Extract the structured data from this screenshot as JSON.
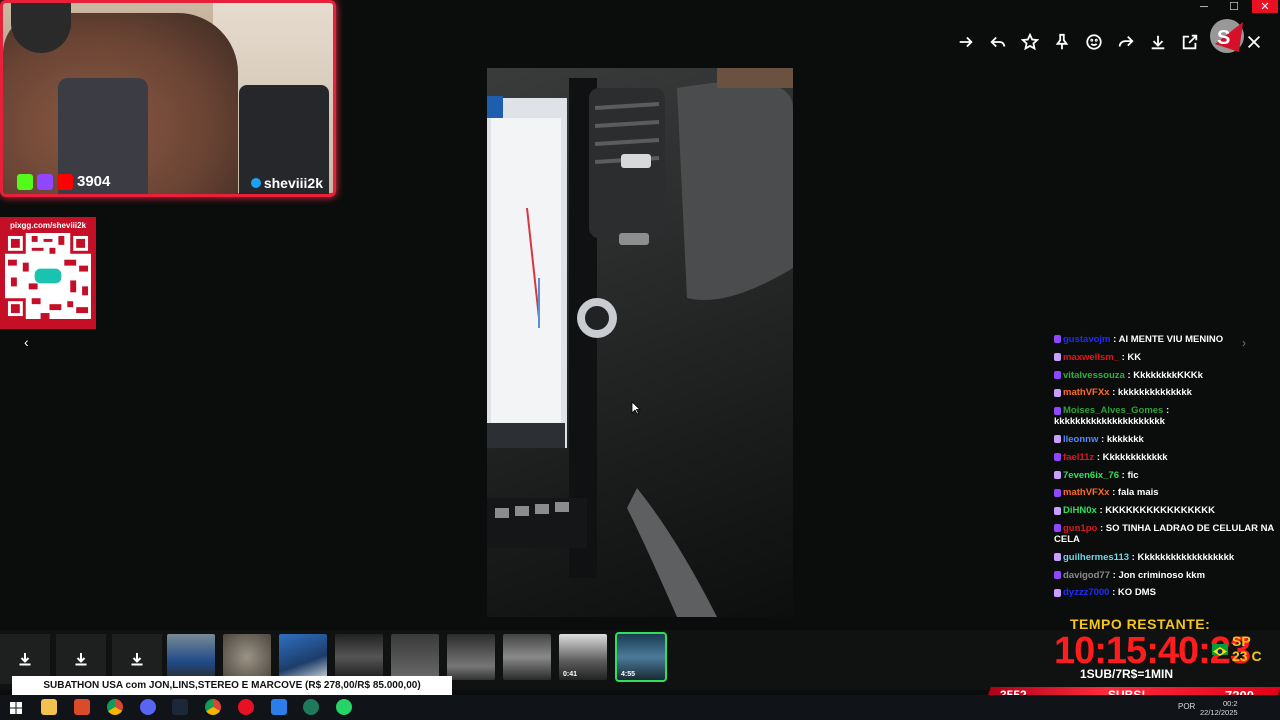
{
  "window": {
    "minimize": "─",
    "maximize": "☐",
    "close": "✕"
  },
  "toolbar": {
    "icons": [
      "forward-icon",
      "reply-icon",
      "star-icon",
      "pin-icon",
      "emoji-icon",
      "share-icon",
      "download-icon",
      "open-external-icon",
      "close-icon"
    ]
  },
  "webcam": {
    "viewers": "3904",
    "streamer": "sheviii2k"
  },
  "qr": {
    "url": "pixgg.com/sheviii2k"
  },
  "chat": [
    {
      "user": "gustavojm",
      "color": "#1e2cff",
      "msg": ": AI MENTE VIU MENINO"
    },
    {
      "user": "maxwellsm_",
      "color": "#e0141e",
      "msg": ": KK"
    },
    {
      "user": "vitalvessouza",
      "color": "#28b33c",
      "msg": ": KkkkkkkkKKKk"
    },
    {
      "user": "mathVFXx",
      "color": "#ff6b2b",
      "msg": ": kkkkkkkkkkkkkk"
    },
    {
      "user": "Moises_Alves_Gomes",
      "color": "#2fa03c",
      "msg": ": kkkkkkkkkkkkkkkkkkkkk"
    },
    {
      "user": "lleonnw",
      "color": "#4c8cff",
      "msg": ": kkkkkkk"
    },
    {
      "user": "fael11z",
      "color": "#e0141e",
      "msg": ": Kkkkkkkkkkkk"
    },
    {
      "user": "7even6ix_76",
      "color": "#2fe05a",
      "msg": ": fic"
    },
    {
      "user": "mathVFXx",
      "color": "#ff6b2b",
      "msg": ": fala mais"
    },
    {
      "user": "DiHN0x",
      "color": "#2fe05a",
      "msg": ": KKKKKKKKKKKKKKKK"
    },
    {
      "user": "gun1po",
      "color": "#e0141e",
      "msg": ": SO TINHA LADRAO DE CELULAR NA CELA"
    },
    {
      "user": "guilhermes113",
      "color": "#6fd6e8",
      "msg": ": Kkkkkkkkkkkkkkkkkk"
    },
    {
      "user": "davigod77",
      "color": "#8a8a8a",
      "msg": ": Jon criminoso kkm"
    },
    {
      "user": "dyzzz7000",
      "color": "#1e2cff",
      "msg": ": KO DMS"
    }
  ],
  "thumbnails": [
    {
      "duration": ""
    },
    {
      "duration": ""
    },
    {
      "duration": ""
    },
    {
      "duration": ""
    },
    {
      "duration": ""
    },
    {
      "duration": ""
    },
    {
      "duration": ""
    },
    {
      "duration": "0:41"
    },
    {
      "duration": "4:55"
    }
  ],
  "ticker": {
    "text": "SUBATHON USA com JON,LINS,STEREO E MARCOVE (R$ 278,00/R$ 85.000,00)"
  },
  "subathon": {
    "label": "TEMPO RESTANTE:",
    "timer": "10:15:40:23",
    "city": "SP",
    "temp": "23 C",
    "rate": "1SUB/7R$=1MIN",
    "subs_left": "3552",
    "subs_label": "SUBS!",
    "subs_right": "7200"
  },
  "taskbar": {
    "lang": "POR",
    "time": "00:2",
    "date": "22/12/2025"
  }
}
